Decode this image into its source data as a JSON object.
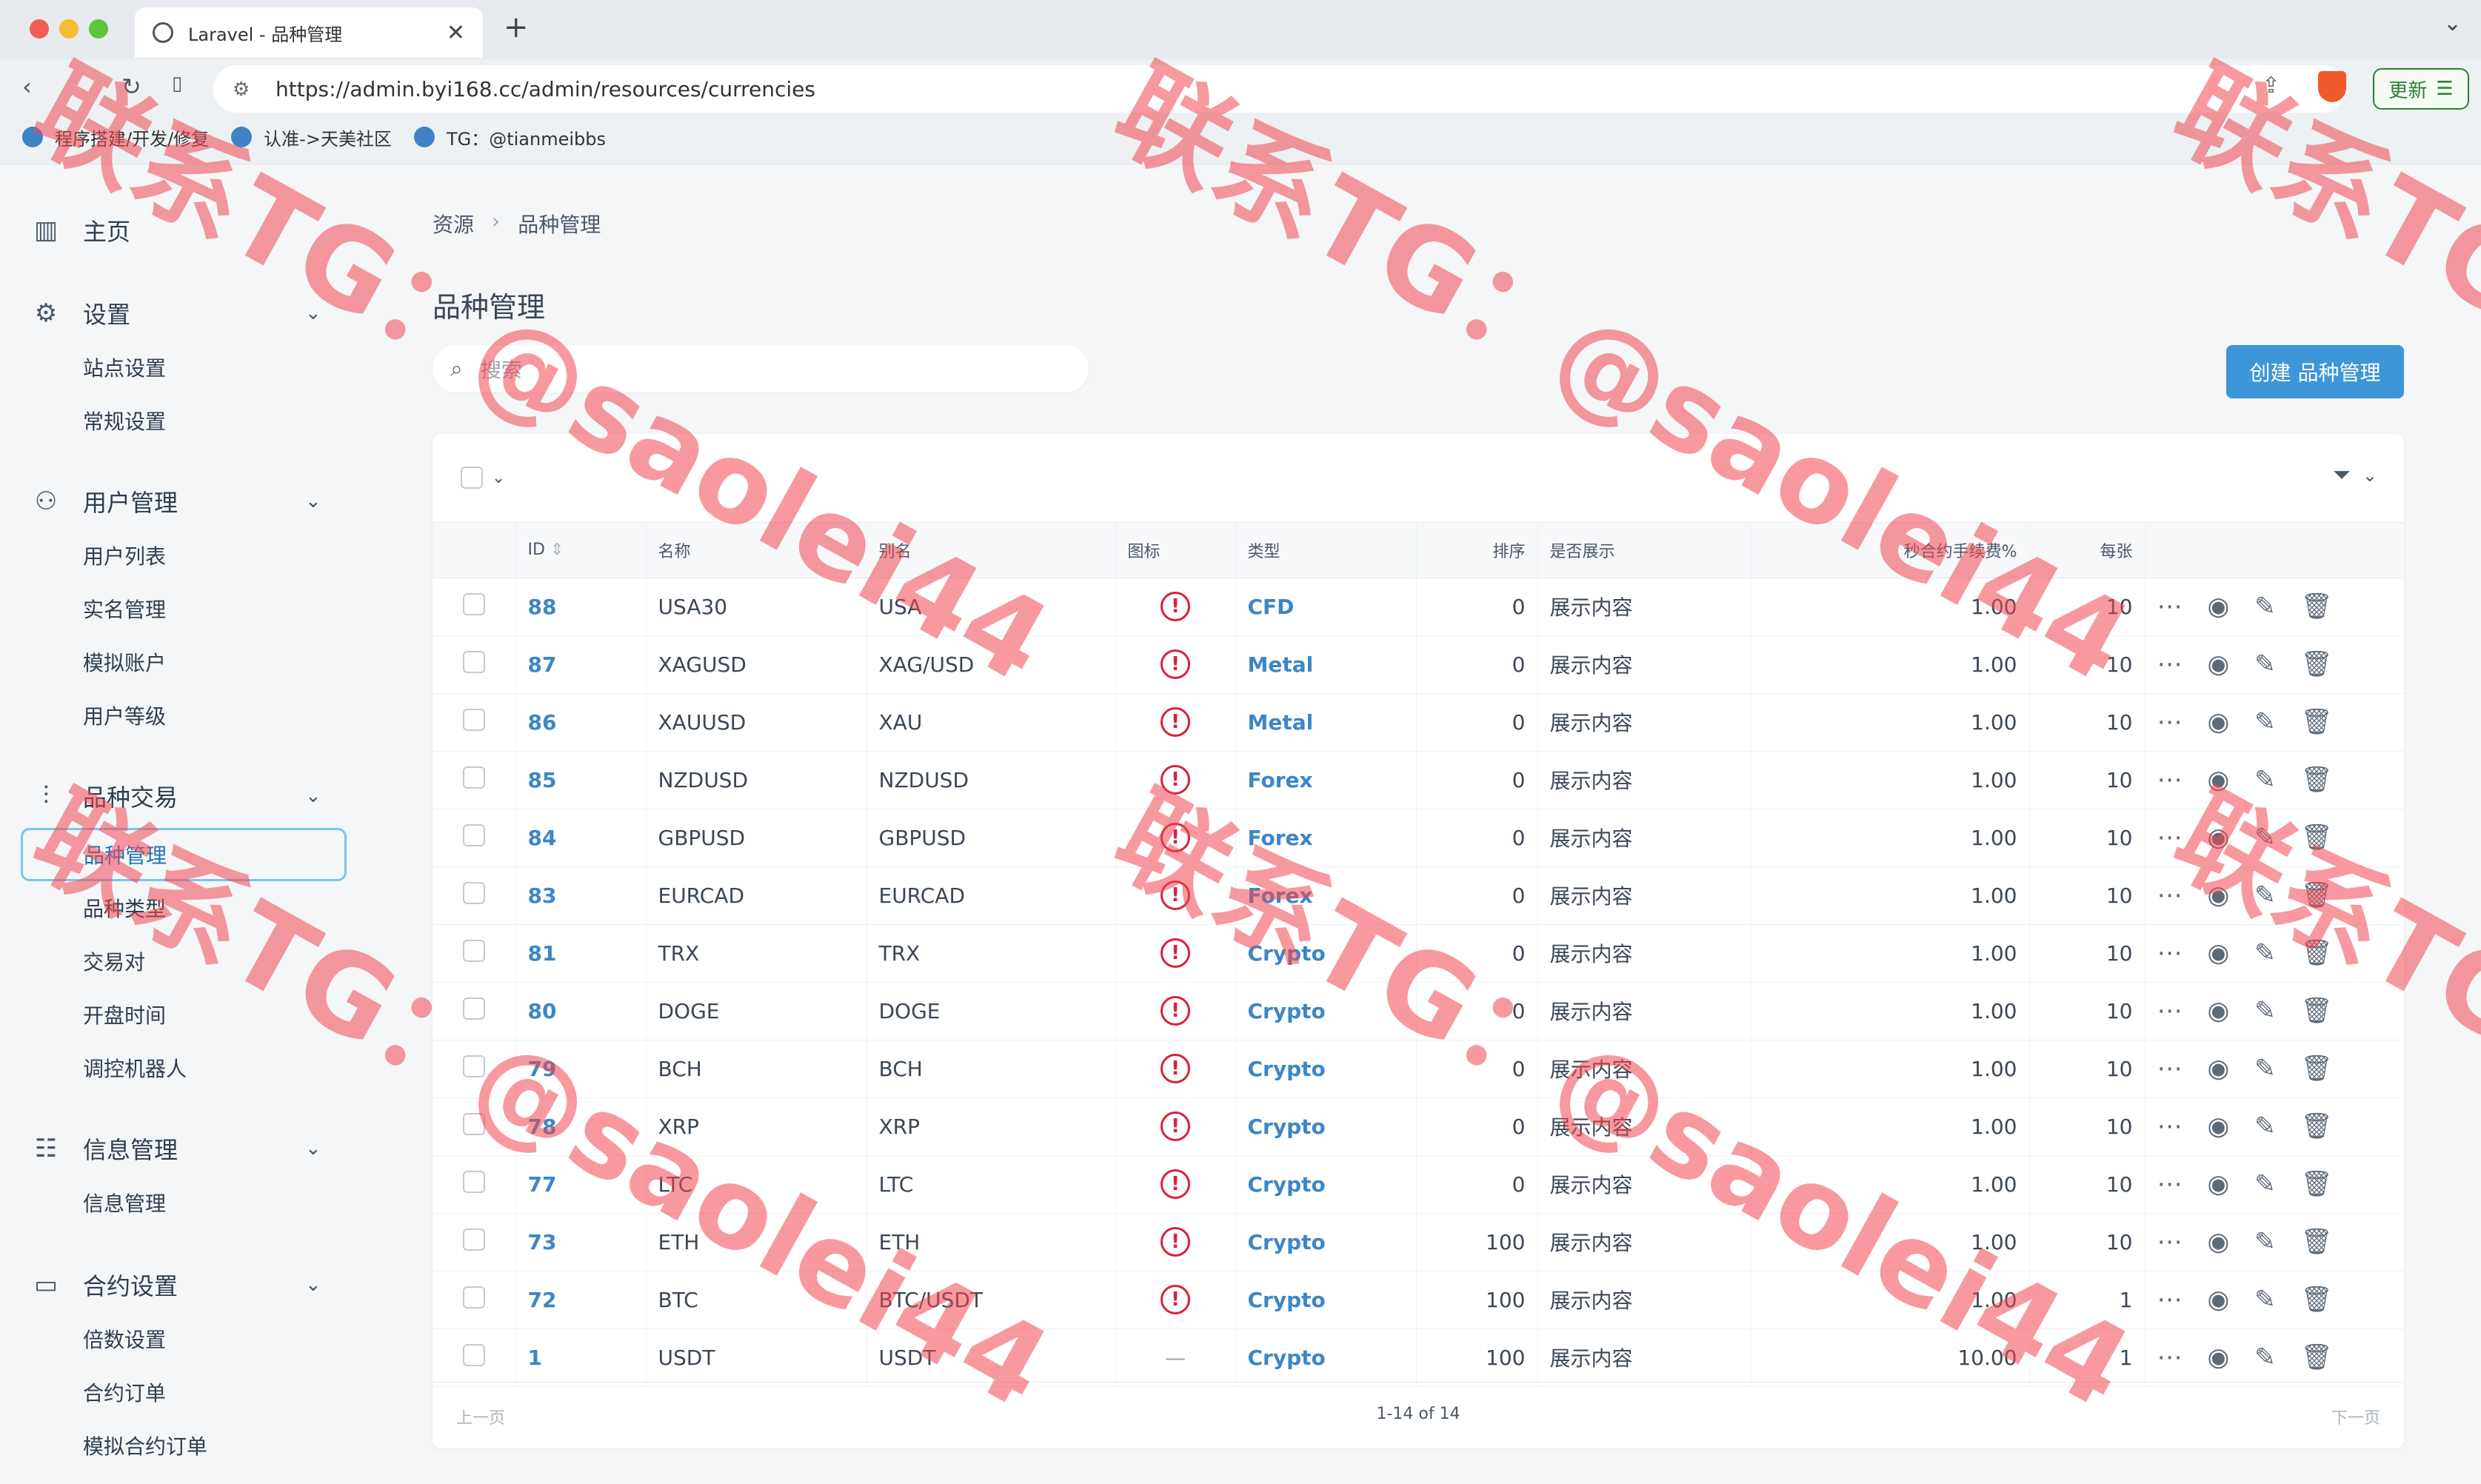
{
  "browser": {
    "tab_title": "Laravel - 品种管理",
    "tab_close": "✕",
    "new_tab": "+",
    "url": "https://admin.byi168.cc/admin/resources/currencies",
    "update_label": "更新",
    "bookmarks": [
      "程序搭建/开发/修复",
      "认准->天美社区",
      "TG：@tianmeibbs"
    ]
  },
  "sidebar": {
    "home": "主页",
    "settings": {
      "label": "设置",
      "items": [
        "站点设置",
        "常规设置"
      ]
    },
    "users": {
      "label": "用户管理",
      "items": [
        "用户列表",
        "实名管理",
        "模拟账户",
        "用户等级"
      ]
    },
    "trading": {
      "label": "品种交易",
      "items": [
        "品种管理",
        "品种类型",
        "交易对",
        "开盘时间",
        "调控机器人"
      ]
    },
    "messages": {
      "label": "信息管理",
      "items": [
        "信息管理"
      ]
    },
    "contracts": {
      "label": "合约设置",
      "items": [
        "倍数设置",
        "合约订单",
        "模拟合约订单"
      ]
    }
  },
  "main": {
    "breadcrumb": [
      "资源",
      "品种管理"
    ],
    "title": "品种管理",
    "search_placeholder": "搜索",
    "create_label": "创建 品种管理",
    "columns": [
      "ID",
      "名称",
      "别名",
      "图标",
      "类型",
      "排序",
      "是否展示",
      "秒合约手续费%",
      "每张"
    ],
    "rows": [
      {
        "id": "88",
        "name": "USA30",
        "alias": "USA",
        "icon": "!",
        "type": "CFD",
        "sort": "0",
        "show": "展示内容",
        "fee": "1.00",
        "per": "10"
      },
      {
        "id": "87",
        "name": "XAGUSD",
        "alias": "XAG/USD",
        "icon": "!",
        "type": "Metal",
        "sort": "0",
        "show": "展示内容",
        "fee": "1.00",
        "per": "10"
      },
      {
        "id": "86",
        "name": "XAUUSD",
        "alias": "XAU",
        "icon": "!",
        "type": "Metal",
        "sort": "0",
        "show": "展示内容",
        "fee": "1.00",
        "per": "10"
      },
      {
        "id": "85",
        "name": "NZDUSD",
        "alias": "NZDUSD",
        "icon": "!",
        "type": "Forex",
        "sort": "0",
        "show": "展示内容",
        "fee": "1.00",
        "per": "10"
      },
      {
        "id": "84",
        "name": "GBPUSD",
        "alias": "GBPUSD",
        "icon": "!",
        "type": "Forex",
        "sort": "0",
        "show": "展示内容",
        "fee": "1.00",
        "per": "10"
      },
      {
        "id": "83",
        "name": "EURCAD",
        "alias": "EURCAD",
        "icon": "!",
        "type": "Forex",
        "sort": "0",
        "show": "展示内容",
        "fee": "1.00",
        "per": "10"
      },
      {
        "id": "81",
        "name": "TRX",
        "alias": "TRX",
        "icon": "!",
        "type": "Crypto",
        "sort": "0",
        "show": "展示内容",
        "fee": "1.00",
        "per": "10"
      },
      {
        "id": "80",
        "name": "DOGE",
        "alias": "DOGE",
        "icon": "!",
        "type": "Crypto",
        "sort": "0",
        "show": "展示内容",
        "fee": "1.00",
        "per": "10"
      },
      {
        "id": "79",
        "name": "BCH",
        "alias": "BCH",
        "icon": "!",
        "type": "Crypto",
        "sort": "0",
        "show": "展示内容",
        "fee": "1.00",
        "per": "10"
      },
      {
        "id": "78",
        "name": "XRP",
        "alias": "XRP",
        "icon": "!",
        "type": "Crypto",
        "sort": "0",
        "show": "展示内容",
        "fee": "1.00",
        "per": "10"
      },
      {
        "id": "77",
        "name": "LTC",
        "alias": "LTC",
        "icon": "!",
        "type": "Crypto",
        "sort": "0",
        "show": "展示内容",
        "fee": "1.00",
        "per": "10"
      },
      {
        "id": "73",
        "name": "ETH",
        "alias": "ETH",
        "icon": "!",
        "type": "Crypto",
        "sort": "100",
        "show": "展示内容",
        "fee": "1.00",
        "per": "10"
      },
      {
        "id": "72",
        "name": "BTC",
        "alias": "BTC/USDT",
        "icon": "!",
        "type": "Crypto",
        "sort": "100",
        "show": "展示内容",
        "fee": "1.00",
        "per": "1"
      },
      {
        "id": "1",
        "name": "USDT",
        "alias": "USDT",
        "icon": "—",
        "type": "Crypto",
        "sort": "100",
        "show": "展示内容",
        "fee": "10.00",
        "per": "1"
      }
    ],
    "pagination": {
      "prev": "上一页",
      "info": "1-14 of 14",
      "next": "下一页"
    }
  },
  "watermark": "联系TG：@saolei44",
  "colors": {
    "accent": "#3d96d8",
    "link": "#3d86c6",
    "warning": "#d6233b",
    "watermark": "#f04650"
  }
}
